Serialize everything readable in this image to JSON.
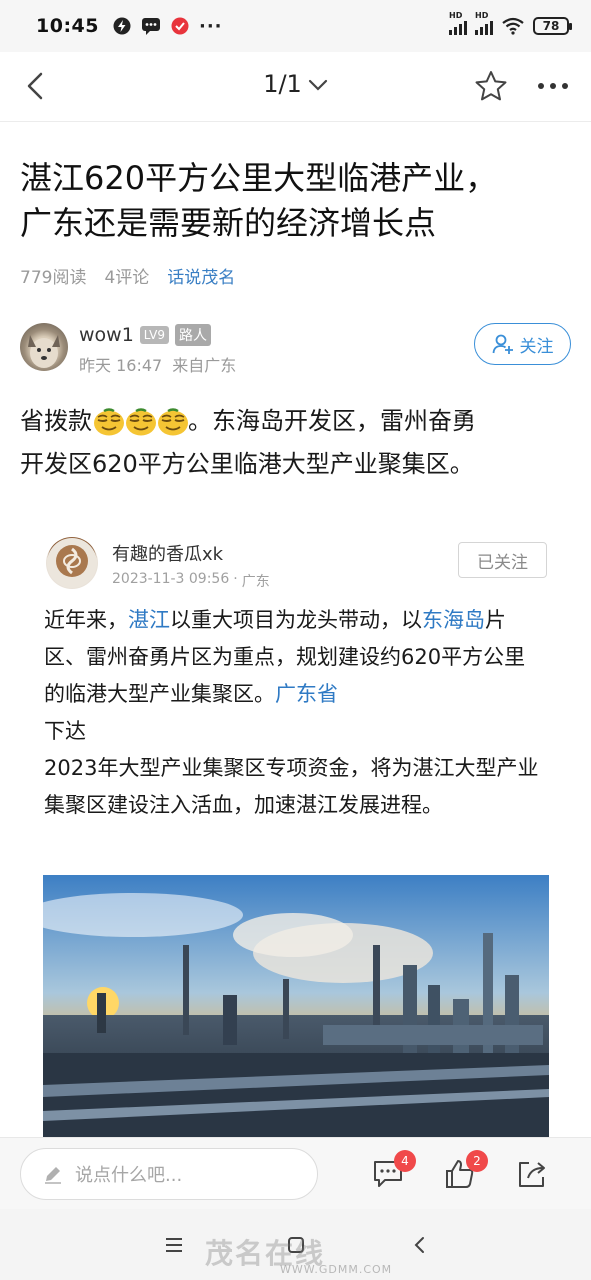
{
  "status_bar": {
    "time": "10:45",
    "battery": "78",
    "signal_label": "HD"
  },
  "nav": {
    "page_indicator": "1/1"
  },
  "post": {
    "title_line1": "湛江620平方公里大型临港产业，",
    "title_line2": "广东还是需要新的经济增长点",
    "reads": "779阅读",
    "comments": "4评论",
    "section": "话说茂名"
  },
  "author": {
    "name": "wow1",
    "level": "LV9",
    "role": "路人",
    "time": "昨天 16:47",
    "location": "来自广东",
    "follow_label": "关注"
  },
  "body": {
    "line1_prefix": "省拨款",
    "line1_suffix": "。东海岛开发区，雷州奋勇",
    "line2": "开发区620平方公里临港大型产业聚集区。"
  },
  "quote": {
    "author": "有趣的香瓜xk",
    "date": "2023-11-3 09:56",
    "region": "广东",
    "followed_label": "已关注",
    "t1": "近年来，",
    "link1": "湛江",
    "t2": "以重大项目为龙头带动，以",
    "link2": "东海岛",
    "t3": "片区、雷州奋勇片区为重点，规划建设约620平方公里的临港大型产业集聚区。",
    "link3": "广东省",
    "t4": "下达",
    "t5": "2023年大型产业集聚区专项资金，将为湛江大型产业集聚区建设注入活血，加速湛江发展进程。"
  },
  "comment_bar": {
    "placeholder": "说点什么吧...",
    "comment_count": "4",
    "like_count": "2"
  },
  "watermark": {
    "text": "茂名在线",
    "url": "WWW.GDMM.COM"
  },
  "colors": {
    "link": "#2f7ac4",
    "follow": "#3a8fd8",
    "badge": "#f0494a"
  }
}
